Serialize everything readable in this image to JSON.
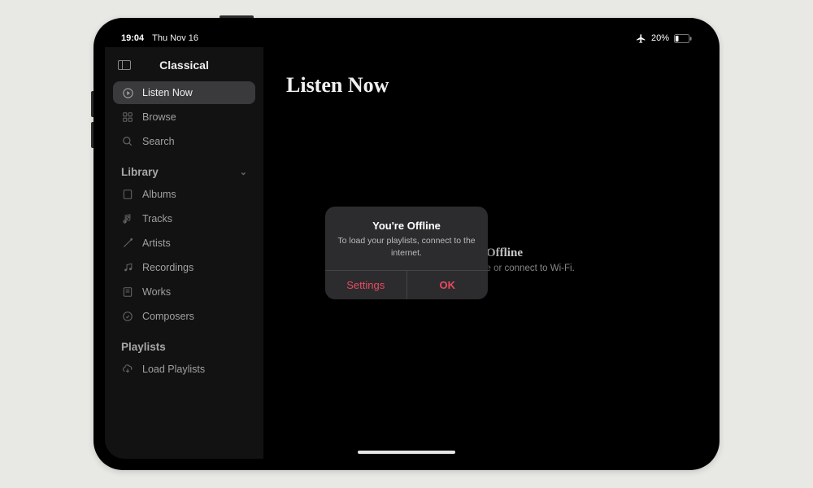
{
  "status": {
    "time": "19:04",
    "date": "Thu Nov 16",
    "battery": "20%"
  },
  "sidebar": {
    "title": "Classical",
    "nav": [
      {
        "label": "Listen Now",
        "icon": "play-circle-icon",
        "active": true
      },
      {
        "label": "Browse",
        "icon": "grid-icon",
        "active": false
      },
      {
        "label": "Search",
        "icon": "search-icon",
        "active": false
      }
    ],
    "library": {
      "title": "Library",
      "items": [
        {
          "label": "Albums",
          "icon": "album-icon"
        },
        {
          "label": "Tracks",
          "icon": "note-icon"
        },
        {
          "label": "Artists",
          "icon": "baton-icon"
        },
        {
          "label": "Recordings",
          "icon": "recordings-icon"
        },
        {
          "label": "Works",
          "icon": "score-icon"
        },
        {
          "label": "Composers",
          "icon": "composer-icon"
        }
      ]
    },
    "playlists": {
      "title": "Playlists",
      "items": [
        {
          "label": "Load Playlists",
          "icon": "cloud-download-icon"
        }
      ]
    }
  },
  "main": {
    "title": "Listen Now",
    "bg_title": "You're Offline",
    "bg_sub": "Turn off Airplane Mode or connect to Wi-Fi."
  },
  "alert": {
    "title": "You're Offline",
    "message": "To load your playlists, connect to the internet.",
    "settings": "Settings",
    "ok": "OK"
  }
}
